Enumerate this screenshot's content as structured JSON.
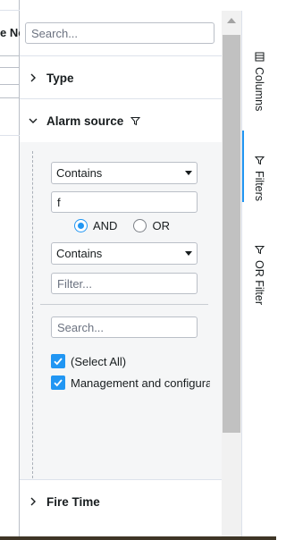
{
  "grid": {
    "header_fragment": "e No"
  },
  "tool_panel": {
    "search": {
      "placeholder": "Search..."
    },
    "groups": [
      {
        "label": "Type",
        "expanded": false
      },
      {
        "label": "Alarm source",
        "expanded": true,
        "filter_active": true
      },
      {
        "label": "Fire Time",
        "expanded": false
      }
    ],
    "alarm_source_filter": {
      "condition1": {
        "type": "Contains",
        "value": "f"
      },
      "join": {
        "options": [
          "AND",
          "OR"
        ],
        "selected": "AND"
      },
      "condition2": {
        "type": "Contains",
        "placeholder": "Filter..."
      },
      "set_search": {
        "placeholder": "Search..."
      },
      "values": [
        {
          "label": "(Select All)",
          "checked": true
        },
        {
          "label": "Management and configuration",
          "checked": true
        }
      ]
    }
  },
  "side_bar": {
    "tabs": [
      {
        "label": "Columns",
        "icon": "columns-icon",
        "active": false
      },
      {
        "label": "Filters",
        "icon": "filter-icon",
        "active": true
      },
      {
        "label": "OR Filter",
        "icon": "filter-icon",
        "active": false
      }
    ]
  },
  "colors": {
    "accent": "#2196f3",
    "border": "#babfc7",
    "panel_bg": "#f5f6f7"
  }
}
